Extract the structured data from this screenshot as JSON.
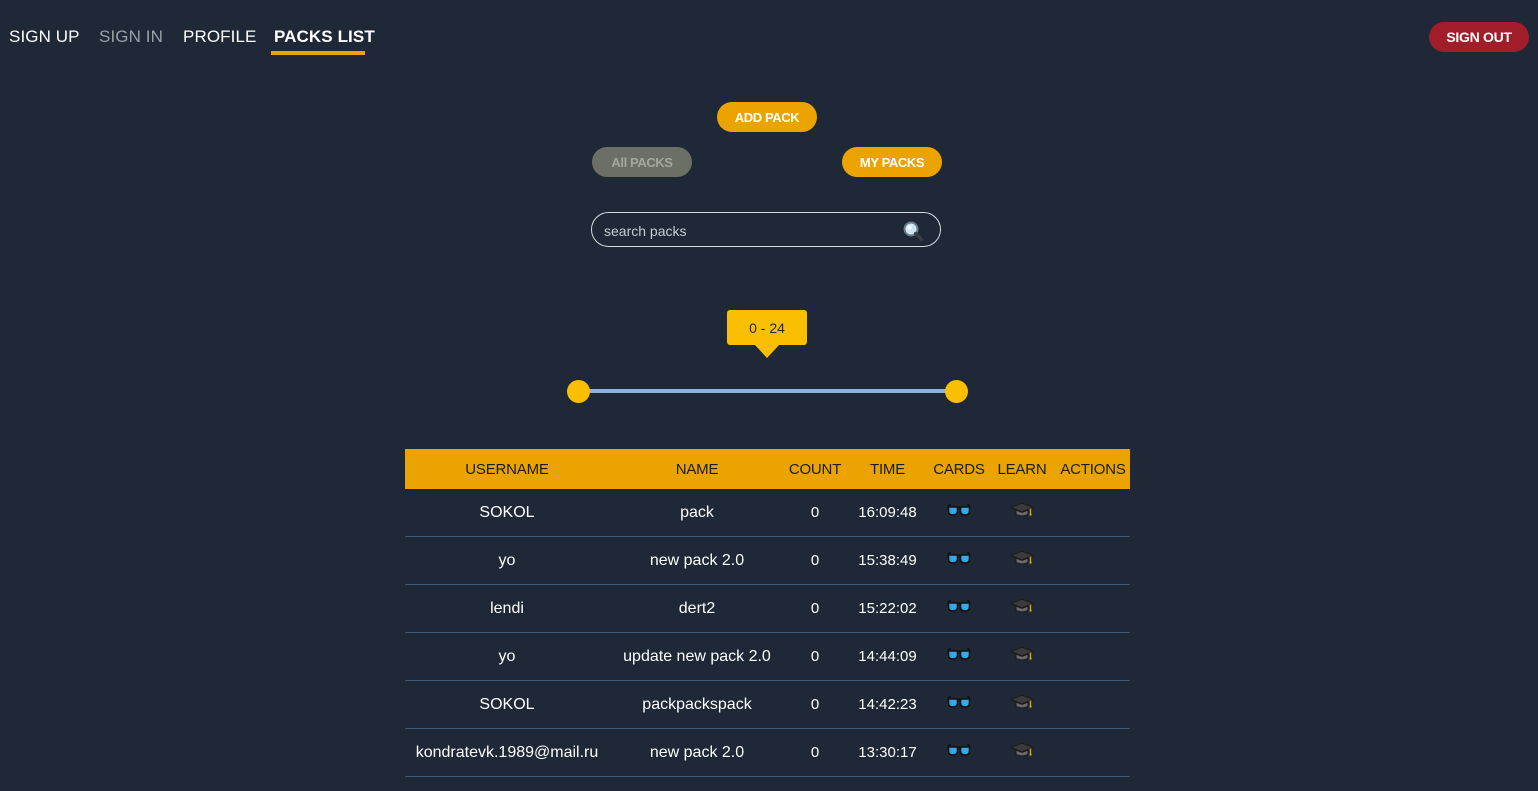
{
  "nav": {
    "sign_up": "SIGN UP",
    "sign_in": "SIGN IN",
    "profile": "PROFILE",
    "packs_list": "PACKS LIST",
    "sign_out": "SIGN OUT"
  },
  "actions": {
    "add_pack": "ADD PACK",
    "all_packs": "All PACKS",
    "my_packs": "MY PACKS"
  },
  "search": {
    "placeholder": "search packs",
    "value": ""
  },
  "range": {
    "label": "0 - 24",
    "min": 0,
    "max": 24
  },
  "table": {
    "headers": {
      "username": "USERNAME",
      "name": "NAME",
      "count": "COUNT",
      "time": "TIME",
      "cards": "CARDS",
      "learn": "LEARN",
      "actions": "ACTIONS"
    },
    "rows": [
      {
        "username": "SOKOL",
        "name": "pack",
        "count": "0",
        "time": "16:09:48"
      },
      {
        "username": "yo",
        "name": "new pack 2.0",
        "count": "0",
        "time": "15:38:49"
      },
      {
        "username": "lendi",
        "name": "dert2",
        "count": "0",
        "time": "15:22:02"
      },
      {
        "username": "yo",
        "name": "update new pack 2.0",
        "count": "0",
        "time": "14:44:09"
      },
      {
        "username": "SOKOL",
        "name": "packpackspack",
        "count": "0",
        "time": "14:42:23"
      },
      {
        "username": "kondratevk.1989@mail.ru",
        "name": "new pack 2.0",
        "count": "0",
        "time": "13:30:17"
      }
    ]
  },
  "icons": {
    "cards": "glasses-icon",
    "learn": "graduation-cap-icon",
    "search": "magnifier-icon"
  },
  "colors": {
    "background": "#1e2836",
    "accent": "#eaa300",
    "slider": "#fbbf02",
    "track": "#8fb3e0",
    "sign_out": "#a11d2a",
    "inactive_pill": "#6c6f66"
  }
}
